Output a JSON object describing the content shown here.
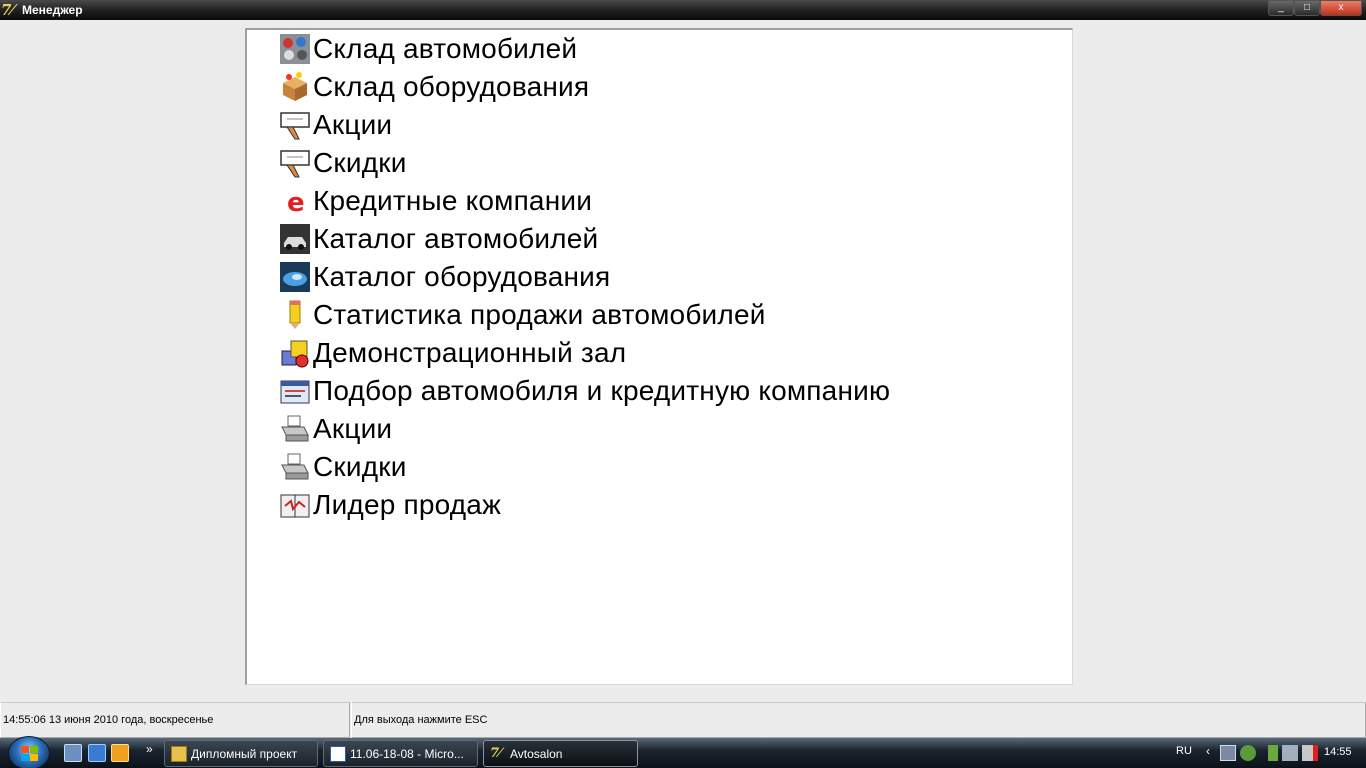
{
  "window": {
    "title": "Менеджер",
    "minimize": "_",
    "maximize": "□",
    "close": "x"
  },
  "menu": [
    {
      "label": "Склад автомобилей",
      "icon": "car-warehouse-icon"
    },
    {
      "label": "Склад оборудования",
      "icon": "equipment-box-icon"
    },
    {
      "label": "Акции",
      "icon": "promo-hand-icon"
    },
    {
      "label": "Скидки",
      "icon": "discount-hand-icon"
    },
    {
      "label": "Кредитные компании",
      "icon": "ie-letter-icon"
    },
    {
      "label": "Каталог автомобилей",
      "icon": "car-photo-icon"
    },
    {
      "label": "Каталог оборудования",
      "icon": "equipment-photo-icon"
    },
    {
      "label": "Статистика продажи автомобилей",
      "icon": "pencil-icon"
    },
    {
      "label": "Демонстрационный зал",
      "icon": "shapes-icon"
    },
    {
      "label": "Подбор автомобиля и кредитную компанию",
      "icon": "form-icon"
    },
    {
      "label": "Акции",
      "icon": "printer-icon"
    },
    {
      "label": "Скидки",
      "icon": "printer-icon"
    },
    {
      "label": "Лидер продаж",
      "icon": "book-icon"
    }
  ],
  "status": {
    "datetime": "14:55:06  13 июня 2010 года, воскресенье",
    "hint": "Для выхода нажмите ESC"
  },
  "taskbar": {
    "tasks": [
      {
        "label": "Дипломный проект",
        "icon": "folder-icon"
      },
      {
        "label": "11.06-18-08 - Micro...",
        "icon": "word-icon"
      },
      {
        "label": "Avtosalon",
        "icon": "app-icon"
      }
    ],
    "overflow": "»",
    "tray_chevron": "‹",
    "language": "RU",
    "clock": "14:55"
  },
  "colors": {
    "panel_bg": "#ffffff",
    "window_bg": "#ececec",
    "accent_red": "#e02020"
  }
}
